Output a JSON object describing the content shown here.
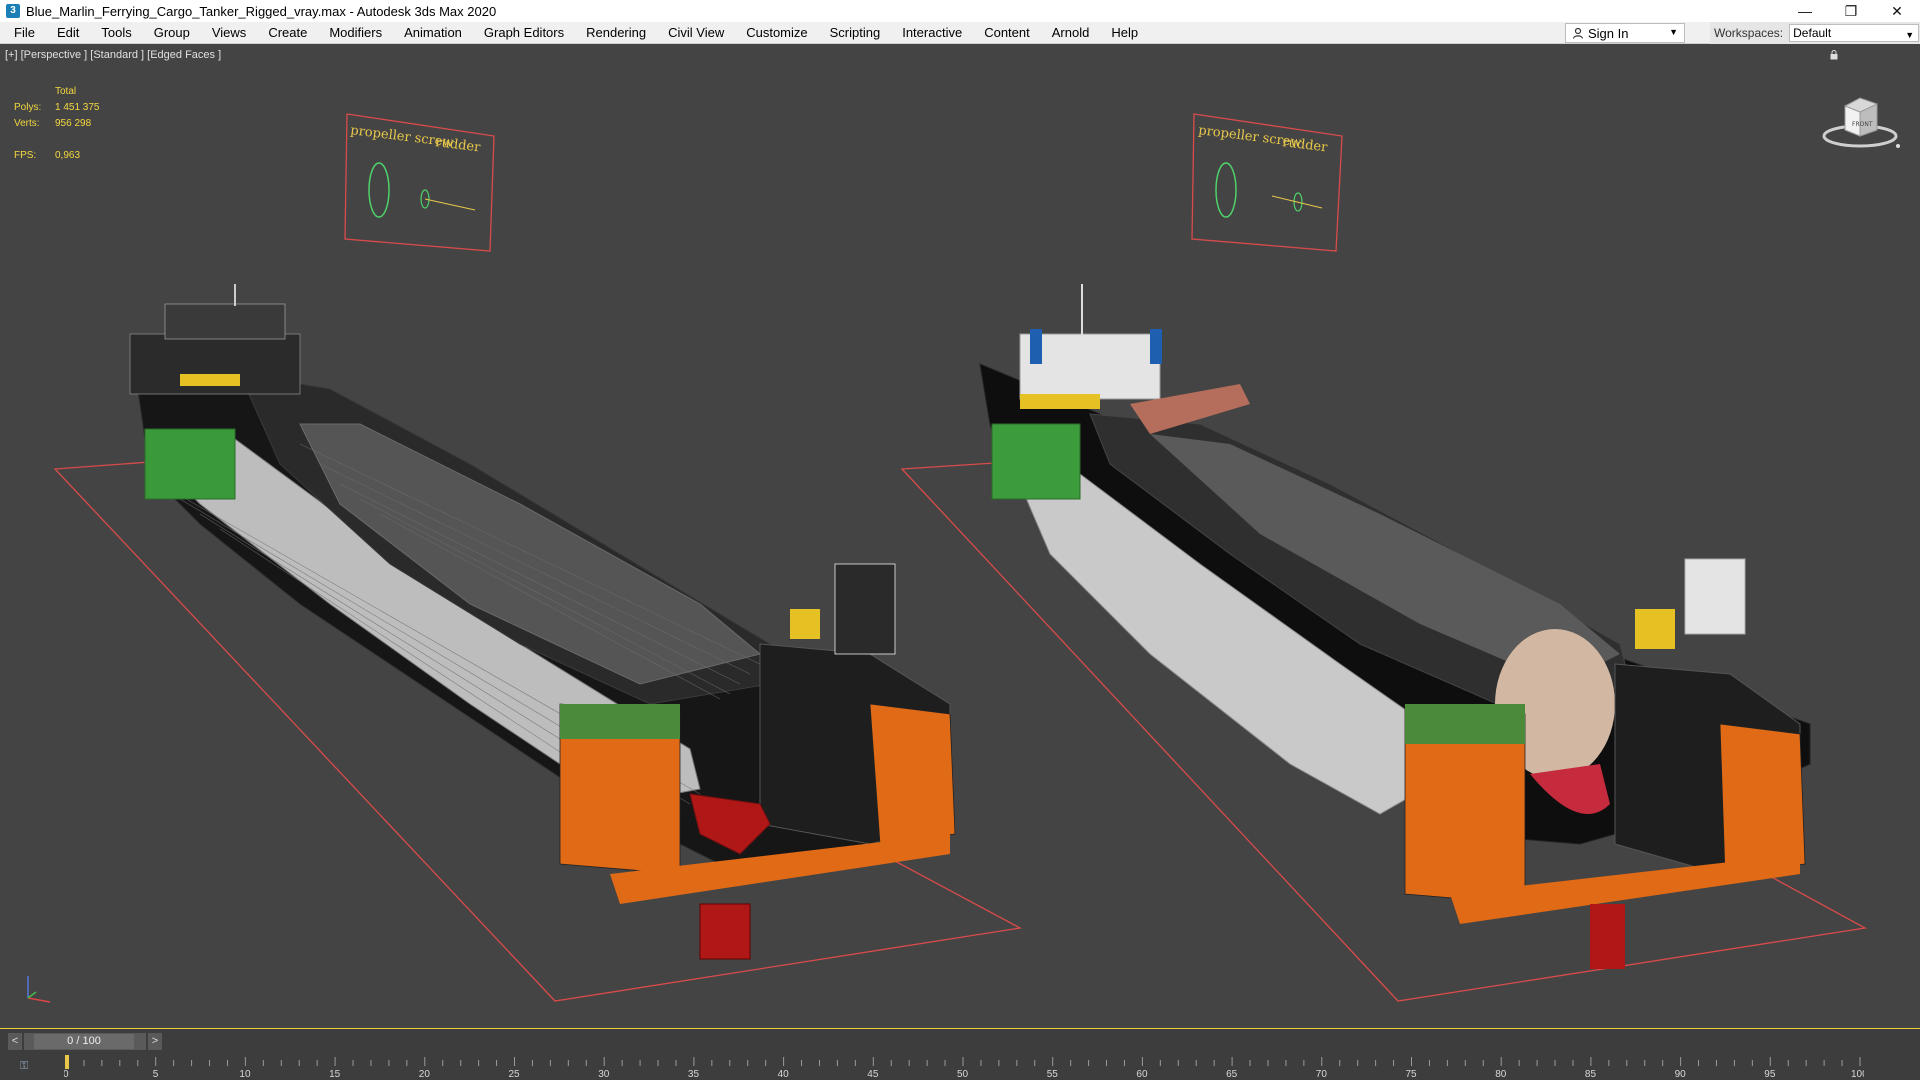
{
  "window": {
    "title": "Blue_Marlin_Ferrying_Cargo_Tanker_Rigged_vray.max - Autodesk 3ds Max 2020",
    "app_icon": "3ds-max-icon",
    "controls": [
      "minimize",
      "restore",
      "close"
    ]
  },
  "menu": {
    "items": [
      "File",
      "Edit",
      "Tools",
      "Group",
      "Views",
      "Create",
      "Modifiers",
      "Animation",
      "Graph Editors",
      "Rendering",
      "Civil View",
      "Customize",
      "Scripting",
      "Interactive",
      "Content",
      "Arnold",
      "Help"
    ],
    "sign_in": "Sign In",
    "workspaces_label": "Workspaces:",
    "workspace_value": "Default"
  },
  "viewport": {
    "label": "[+] [Perspective ] [Standard ] [Edged Faces ]",
    "stats": {
      "total_label": "Total",
      "polys_label": "Polys:",
      "polys_value": "1 451 375",
      "verts_label": "Verts:",
      "verts_value": "956 298",
      "fps_label": "FPS:",
      "fps_value": "0,963"
    },
    "controller_panels": [
      {
        "label_a": "propeller screw",
        "label_b": "rudder"
      },
      {
        "label_a": "propeller screw",
        "label_b": "rudder"
      }
    ],
    "viewcube_face": "FRONT",
    "colors": {
      "panel_border": "#d94b4b",
      "panel_text": "#e8c84a",
      "controller_green": "#4fd16a",
      "stats_yellow": "#f3d83f"
    }
  },
  "timeline": {
    "frame_display": "0 / 100",
    "prev_symbol": "<",
    "next_symbol": ">",
    "ticks": [
      "0",
      "5",
      "10",
      "15",
      "20",
      "25",
      "30",
      "35",
      "40",
      "45",
      "50",
      "55",
      "60",
      "65",
      "70",
      "75",
      "80",
      "85",
      "90",
      "95",
      "100"
    ]
  }
}
